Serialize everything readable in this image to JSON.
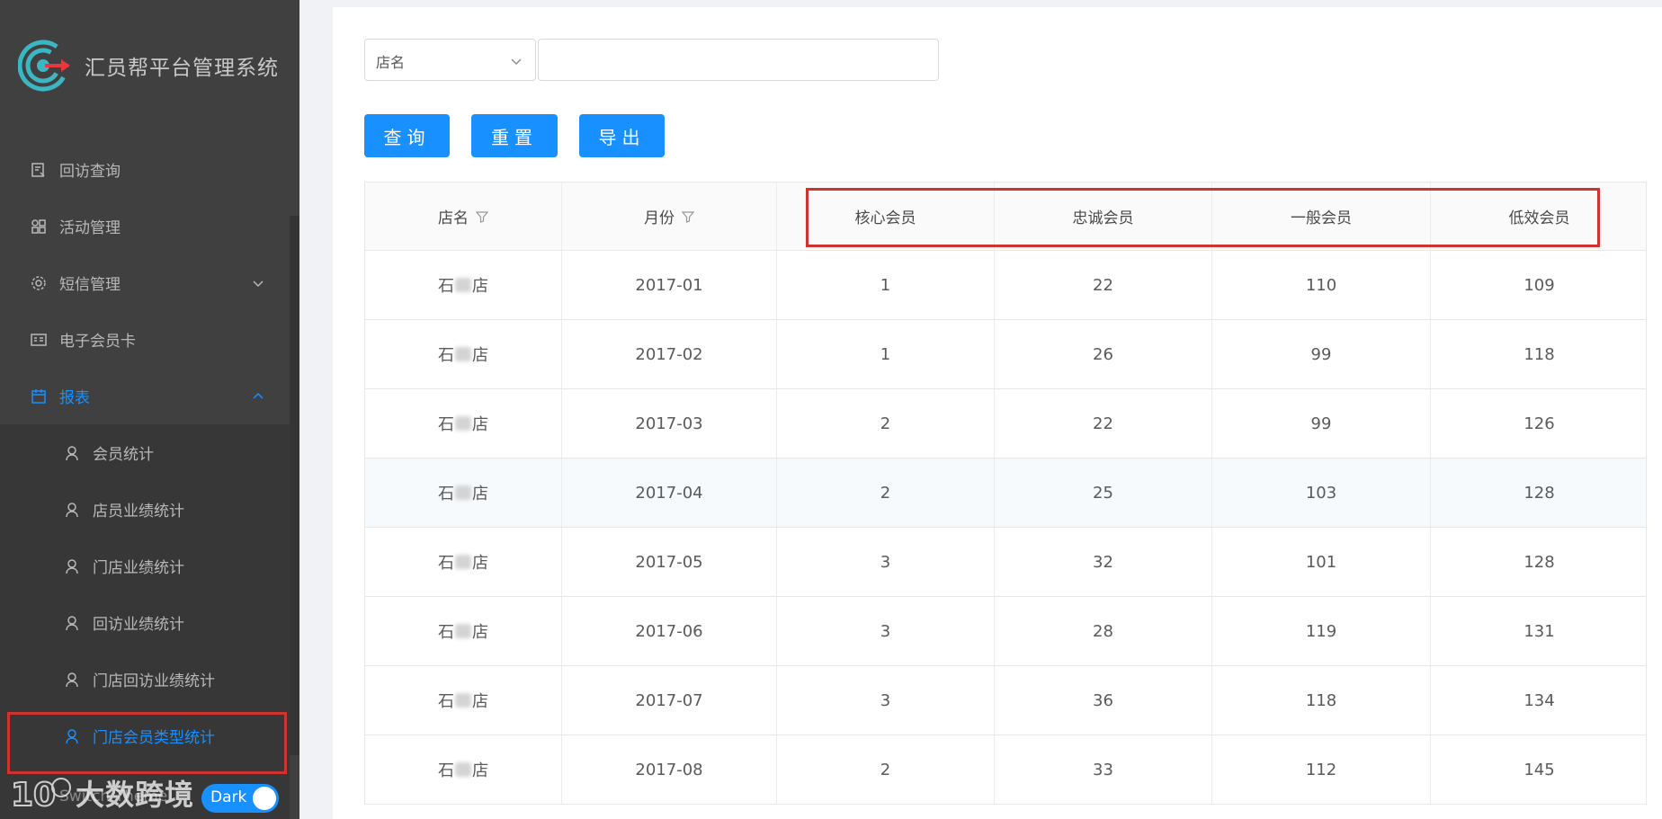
{
  "sidebar": {
    "brand_title": "汇员帮平台管理系统",
    "menu": [
      {
        "label": "回访查询",
        "icon": "visit-query-icon"
      },
      {
        "label": "活动管理",
        "icon": "activity-icon"
      },
      {
        "label": "短信管理",
        "icon": "gear-icon"
      },
      {
        "label": "电子会员卡",
        "icon": "card-icon"
      },
      {
        "label": "报表",
        "icon": "report-icon"
      }
    ],
    "report_submenu": [
      {
        "label": "会员统计"
      },
      {
        "label": "店员业绩统计"
      },
      {
        "label": "门店业绩统计"
      },
      {
        "label": "回访业绩统计"
      },
      {
        "label": "门店回访业绩统计"
      },
      {
        "label": "门店会员类型统计"
      }
    ],
    "switch_label": "Switch Theme",
    "toggle_text": "Dark",
    "watermark_text": "大数跨境"
  },
  "filters": {
    "select_value": "店名",
    "input_value": ""
  },
  "buttons": {
    "query": "查询",
    "reset": "重置",
    "export": "导出"
  },
  "table": {
    "columns": [
      "店名",
      "月份",
      "核心会员",
      "忠诚会员",
      "一般会员",
      "低效会员"
    ],
    "rows": [
      {
        "store_prefix": "石",
        "store_suffix": "店",
        "month": "2017-01",
        "core": "1",
        "loyal": "22",
        "general": "110",
        "low": "109"
      },
      {
        "store_prefix": "石",
        "store_suffix": "店",
        "month": "2017-02",
        "core": "1",
        "loyal": "26",
        "general": "99",
        "low": "118"
      },
      {
        "store_prefix": "石",
        "store_suffix": "店",
        "month": "2017-03",
        "core": "2",
        "loyal": "22",
        "general": "99",
        "low": "126"
      },
      {
        "store_prefix": "石",
        "store_suffix": "店",
        "month": "2017-04",
        "core": "2",
        "loyal": "25",
        "general": "103",
        "low": "128"
      },
      {
        "store_prefix": "石",
        "store_suffix": "店",
        "month": "2017-05",
        "core": "3",
        "loyal": "32",
        "general": "101",
        "low": "128"
      },
      {
        "store_prefix": "石",
        "store_suffix": "店",
        "month": "2017-06",
        "core": "3",
        "loyal": "28",
        "general": "119",
        "low": "131"
      },
      {
        "store_prefix": "石",
        "store_suffix": "店",
        "month": "2017-07",
        "core": "3",
        "loyal": "36",
        "general": "118",
        "low": "134"
      },
      {
        "store_prefix": "石",
        "store_suffix": "店",
        "month": "2017-08",
        "core": "2",
        "loyal": "33",
        "general": "112",
        "low": "145"
      }
    ]
  },
  "colors": {
    "primary": "#1890ff",
    "sidebar_bg": "#404040",
    "highlight_red": "#d0332e"
  }
}
